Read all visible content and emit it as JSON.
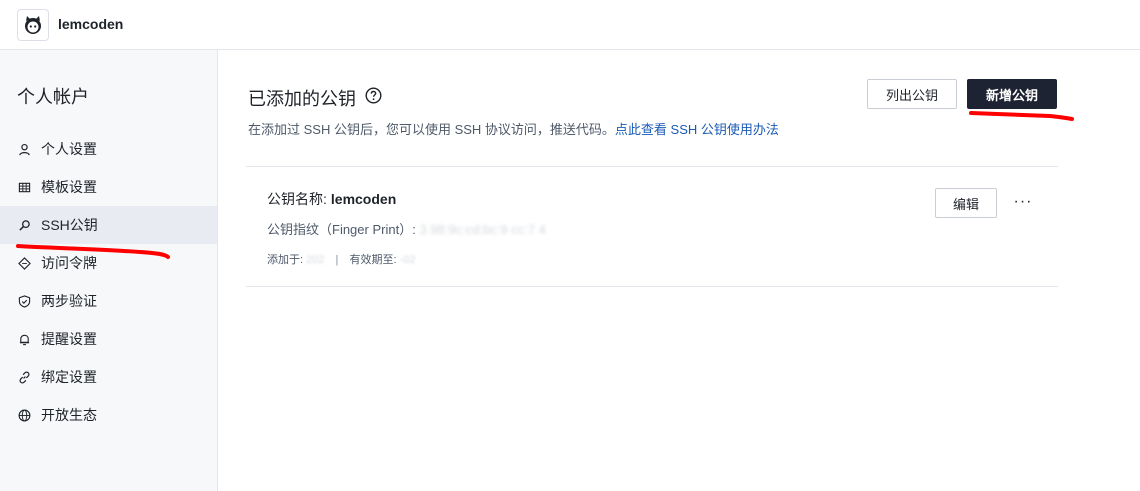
{
  "header": {
    "brand": "lemcoden",
    "logo_icon": "octocat-avatar-icon"
  },
  "sidebar": {
    "title": "个人帐户",
    "items": [
      {
        "label": "个人设置",
        "icon": "user-icon",
        "active": false
      },
      {
        "label": "模板设置",
        "icon": "grid-icon",
        "active": false
      },
      {
        "label": "SSH公钥",
        "icon": "key-search-icon",
        "active": true
      },
      {
        "label": "访问令牌",
        "icon": "ticket-icon",
        "active": false
      },
      {
        "label": "两步验证",
        "icon": "shield-icon",
        "active": false
      },
      {
        "label": "提醒设置",
        "icon": "bell-icon",
        "active": false
      },
      {
        "label": "绑定设置",
        "icon": "link-icon",
        "active": false
      },
      {
        "label": "开放生态",
        "icon": "globe-icon",
        "active": false
      }
    ]
  },
  "main": {
    "title": "已添加的公钥",
    "subtitle_text": "在添加过 SSH 公钥后，您可以使用 SSH 协议访问，推送代码。",
    "subtitle_link": "点此查看 SSH 公钥使用办法",
    "list_button": "列出公钥",
    "add_button": "新增公钥",
    "key": {
      "name_label": "公钥名称:",
      "name_value": "lemcoden",
      "fingerprint_label": "公钥指纹（Finger Print）:",
      "fingerprint_value": "3        98:9c:cd:bc:9           cc:7      4",
      "added_label": "添加于:",
      "added_value": "202        ",
      "expires_label": "有效期至:",
      "expires_value": "          -02",
      "edit_button": "编辑",
      "more_button": "···"
    }
  },
  "colors": {
    "accent_dark": "#1e2333",
    "link": "#1a5bb5",
    "annotation": "#ff0000",
    "sidebar_bg": "#f7f8fa",
    "active_bg": "#e8ebf1"
  }
}
